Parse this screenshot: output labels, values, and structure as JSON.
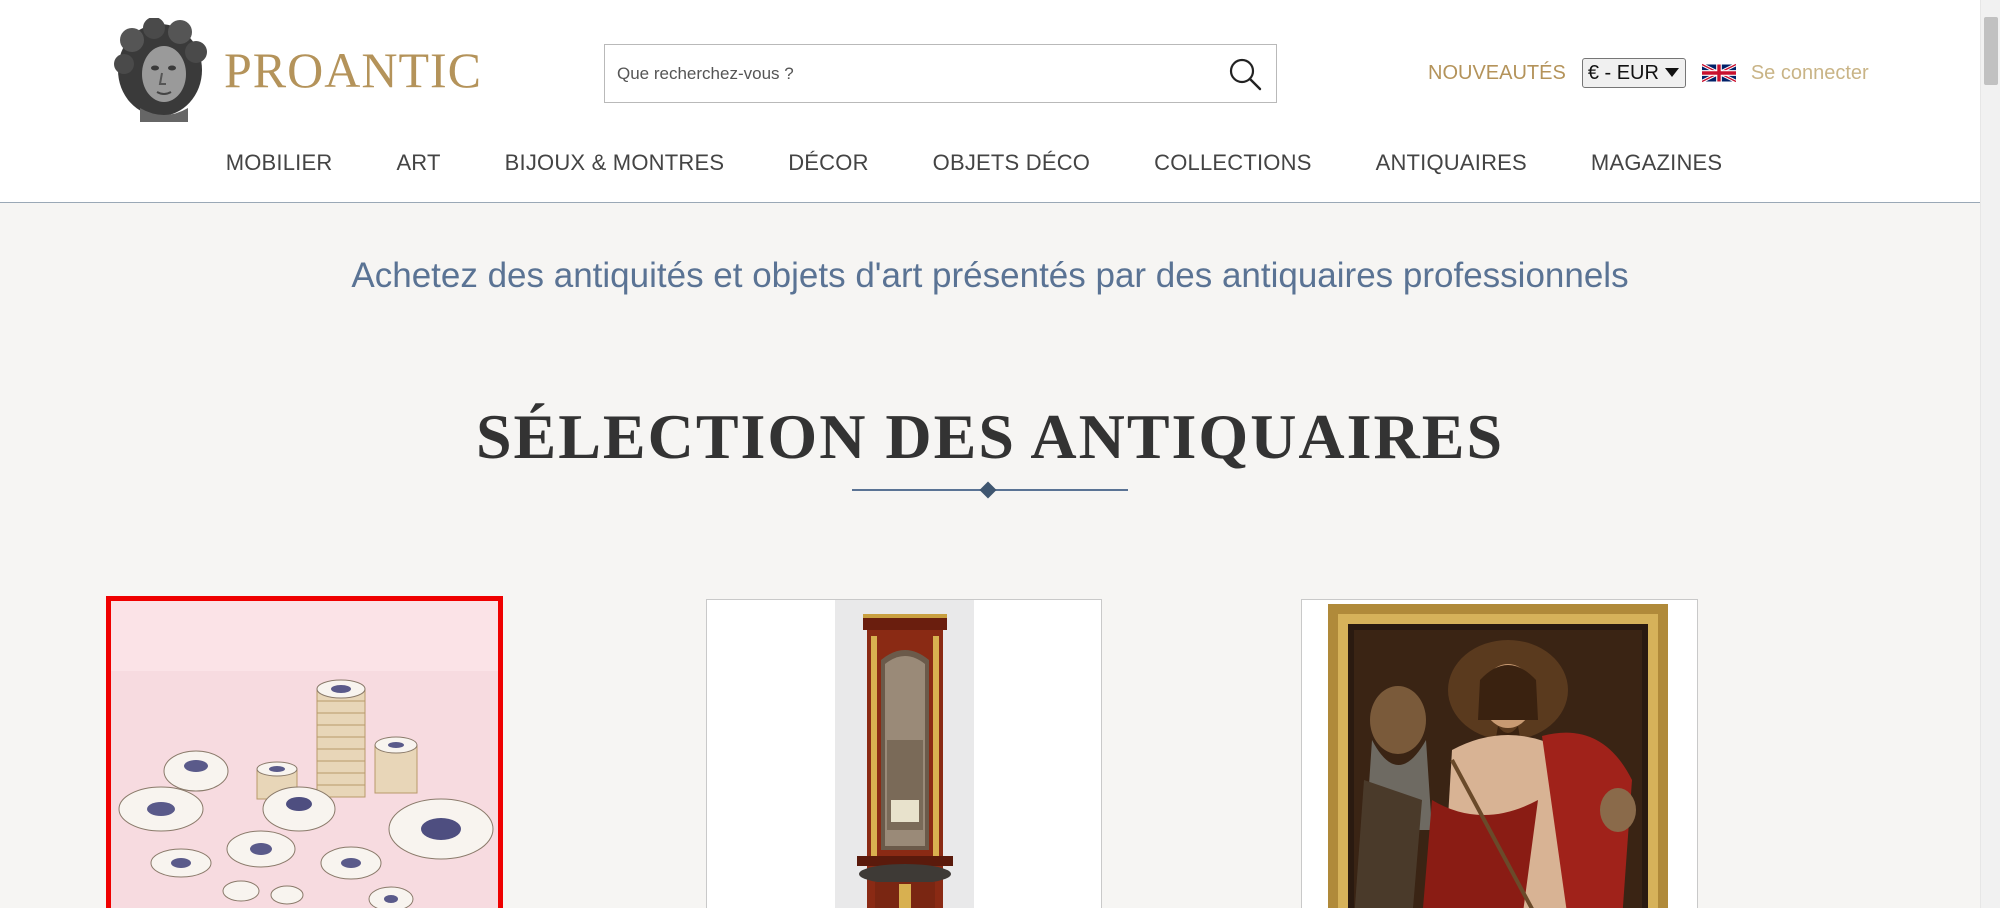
{
  "brand": {
    "name": "PROANTIC",
    "color": "#b4935a"
  },
  "search": {
    "placeholder": "Que recherchez-vous ?"
  },
  "top_bar": {
    "new_label": "NOUVEAUTÉS",
    "currency": "€ - EUR",
    "language_flag": "uk-flag-icon",
    "login_label": "Se connecter"
  },
  "nav": [
    {
      "label": "MOBILIER"
    },
    {
      "label": "ART"
    },
    {
      "label": "BIJOUX & MONTRES"
    },
    {
      "label": "DÉCOR"
    },
    {
      "label": "OBJETS DÉCO"
    },
    {
      "label": "COLLECTIONS"
    },
    {
      "label": "ANTIQUAIRES"
    },
    {
      "label": "MAGAZINES"
    }
  ],
  "tagline": "Achetez des antiquités et objets d'art présentés par des antiquaires professionnels",
  "selection": {
    "title": "SÉLECTION DES ANTIQUAIRES",
    "items": [
      {
        "image": "porcelain-dinner-service-image",
        "highlighted": true
      },
      {
        "image": "mahogany-mirror-console-image",
        "highlighted": false
      },
      {
        "image": "ecce-homo-painting-image",
        "highlighted": false
      }
    ]
  },
  "colors": {
    "accent": "#b4935a",
    "tagline": "#5a7394",
    "highlight": "#ef0000",
    "background": "#f6f5f3"
  }
}
